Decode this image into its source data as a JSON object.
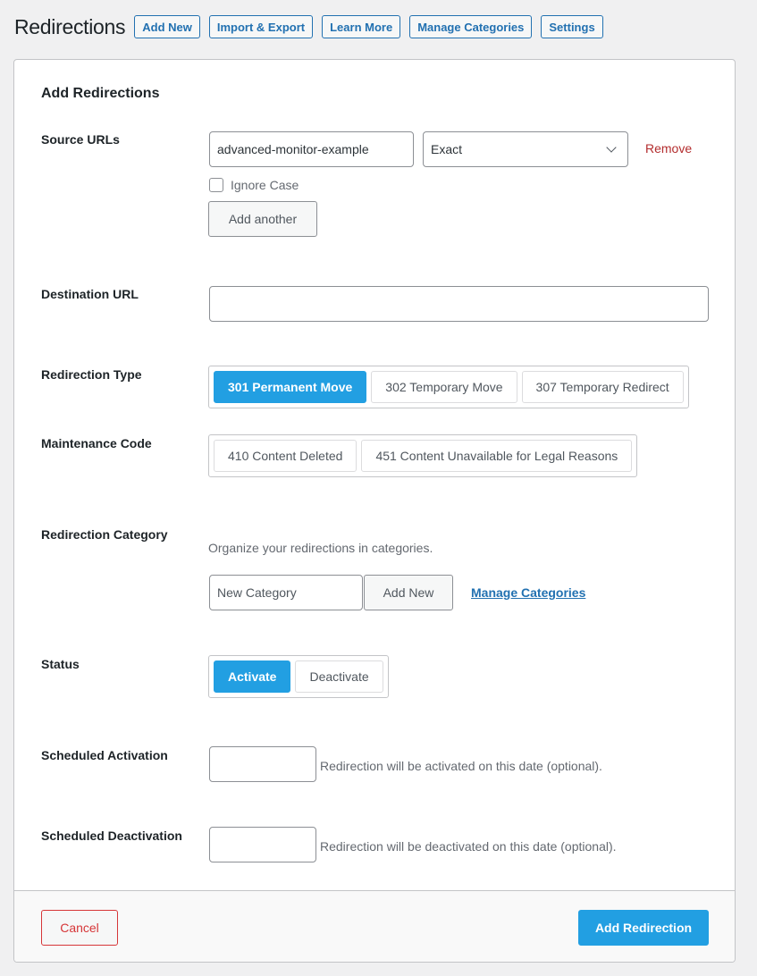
{
  "header": {
    "title": "Redirections",
    "buttons": [
      "Add New",
      "Import & Export",
      "Learn More",
      "Manage Categories",
      "Settings"
    ]
  },
  "form": {
    "title": "Add Redirections",
    "source": {
      "label": "Source URLs",
      "url_value": "advanced-monitor-example",
      "match_type": "Exact",
      "remove_label": "Remove",
      "ignore_case_label": "Ignore Case",
      "ignore_case_checked": false,
      "add_another_label": "Add another"
    },
    "destination": {
      "label": "Destination URL",
      "value": ""
    },
    "redirection_type": {
      "label": "Redirection Type",
      "options": [
        "301 Permanent Move",
        "302 Temporary Move",
        "307 Temporary Redirect"
      ],
      "selected": "301 Permanent Move"
    },
    "maintenance_code": {
      "label": "Maintenance Code",
      "options": [
        "410 Content Deleted",
        "451 Content Unavailable for Legal Reasons"
      ],
      "selected": null
    },
    "category": {
      "label": "Redirection Category",
      "help": "Organize your redirections in categories.",
      "input_placeholder": "New Category",
      "add_button": "Add New",
      "manage_link": "Manage Categories"
    },
    "status": {
      "label": "Status",
      "options": [
        "Activate",
        "Deactivate"
      ],
      "selected": "Activate"
    },
    "scheduled_activation": {
      "label": "Scheduled Activation",
      "value": "",
      "help": "Redirection will be activated on this date (optional)."
    },
    "scheduled_deactivation": {
      "label": "Scheduled Deactivation",
      "value": "",
      "help": "Redirection will be deactivated on this date (optional)."
    }
  },
  "footer": {
    "cancel_label": "Cancel",
    "submit_label": "Add Redirection"
  },
  "colors": {
    "accent": "#229fe2",
    "link": "#2271b1",
    "danger": "#b32d2e",
    "cancel": "#d63638"
  }
}
